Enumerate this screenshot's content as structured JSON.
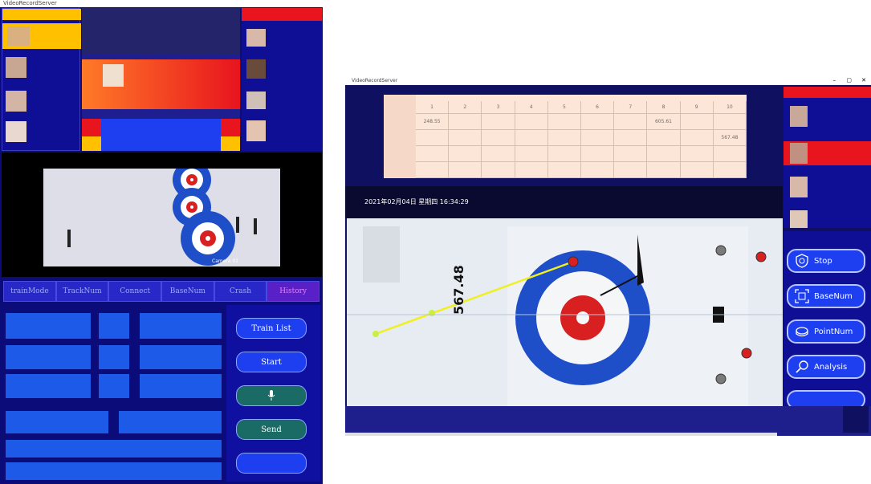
{
  "left_window": {
    "title": "VideoRecordServer",
    "camera_label": "Camera 01",
    "nav_tabs": [
      {
        "label": "trainMode"
      },
      {
        "label": "TrackNum"
      },
      {
        "label": "Connect"
      },
      {
        "label": "BaseNum"
      },
      {
        "label": "Crash"
      },
      {
        "label": "History"
      }
    ],
    "actions": {
      "train_list": "Train List",
      "start": "Start",
      "send": "Send",
      "mic_icon": "microphone-icon"
    },
    "colors": {
      "bg": "#0b0b7a",
      "accent_blue": "#1e3ff0",
      "orange": "#ff6a1e",
      "red": "#e8141e",
      "yellow": "#ffc000"
    }
  },
  "right_window": {
    "title": "VideoRecordServer",
    "window_controls": [
      "–",
      "▢",
      "✕"
    ],
    "table": {
      "columns": [
        "1",
        "2",
        "3",
        "4",
        "5",
        "6",
        "7",
        "8",
        "9",
        "10"
      ],
      "rows": [
        [
          "248.55",
          "",
          "",
          "",
          "",
          "",
          "",
          "605.61",
          "",
          ""
        ],
        [
          "",
          "",
          "",
          "",
          "",
          "",
          "",
          "",
          "",
          "567.48"
        ],
        [
          "",
          "",
          "",
          "",
          "",
          "",
          "",
          "",
          "",
          ""
        ],
        [
          "",
          "",
          "",
          "",
          "",
          "",
          "",
          "",
          "",
          ""
        ]
      ]
    },
    "overlay_timestamp": "2021年02月04日 星期四 16:34:29",
    "measurement": "567.48",
    "side_buttons": [
      {
        "label": "Stop",
        "icon": "stop-shield-icon"
      },
      {
        "label": "BaseNum",
        "icon": "frame-icon"
      },
      {
        "label": "PointNum",
        "icon": "puck-icon"
      },
      {
        "label": "Analysis",
        "icon": "magnifier-icon"
      }
    ]
  }
}
